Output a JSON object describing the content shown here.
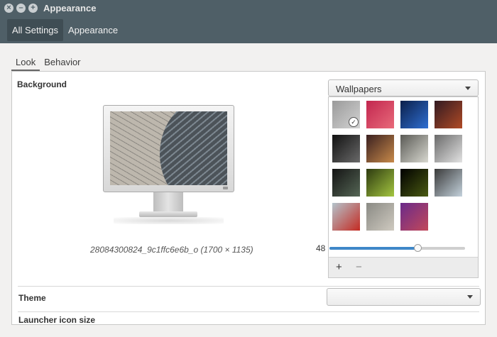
{
  "window": {
    "title": "Appearance"
  },
  "titlebar_icons": [
    "close-icon",
    "minimize-icon",
    "maximize-icon"
  ],
  "breadcrumb": {
    "items": [
      "All Settings",
      "Appearance"
    ]
  },
  "tabs": [
    "Look",
    "Behavior"
  ],
  "background": {
    "label": "Background",
    "caption": "28084300824_9c1ffc6e6b_o (1700 × 1135)",
    "source_selected": "Wallpapers",
    "add_label": "+",
    "remove_label": "−"
  },
  "wallpapers": [
    {
      "name": "cobblestone",
      "colors": [
        "#9a9a9a",
        "#d2d2d2"
      ],
      "selected": true
    },
    {
      "name": "red-abstract",
      "colors": [
        "#c2264f",
        "#e86a7a"
      ]
    },
    {
      "name": "blue-planet",
      "colors": [
        "#0b1f4a",
        "#2f6fd2"
      ]
    },
    {
      "name": "dusk-landscape",
      "colors": [
        "#321a22",
        "#b04a25"
      ]
    },
    {
      "name": "pocket-watch",
      "colors": [
        "#111111",
        "#6a6a6a"
      ]
    },
    {
      "name": "colorful-closeup",
      "colors": [
        "#3a2020",
        "#c88a4a"
      ]
    },
    {
      "name": "frost-leaves",
      "colors": [
        "#5a5a55",
        "#d8d8d0"
      ]
    },
    {
      "name": "ice-crystals",
      "colors": [
        "#6a6a6a",
        "#e2e2e2"
      ]
    },
    {
      "name": "dark-forest",
      "colors": [
        "#141414",
        "#556655"
      ]
    },
    {
      "name": "green-macro",
      "colors": [
        "#2d3a10",
        "#a4c640"
      ]
    },
    {
      "name": "yellow-flower",
      "colors": [
        "#000000",
        "#4a5a12"
      ]
    },
    {
      "name": "foggy-coast",
      "colors": [
        "#3a3a3a",
        "#c4d2dc"
      ]
    },
    {
      "name": "red-poppies",
      "colors": [
        "#b4c4cc",
        "#c42a22"
      ]
    },
    {
      "name": "cobblestone-light",
      "colors": [
        "#8a8a84",
        "#cfcac0"
      ]
    },
    {
      "name": "purple-gradient",
      "colors": [
        "#6a2a8a",
        "#c2485a"
      ]
    }
  ],
  "theme": {
    "label": "Theme",
    "selected": ""
  },
  "launcher": {
    "label": "Launcher icon size",
    "value": "48",
    "fraction": 0.65
  },
  "colors": {
    "header": "#4f5f67",
    "accent": "#3f87c8"
  }
}
